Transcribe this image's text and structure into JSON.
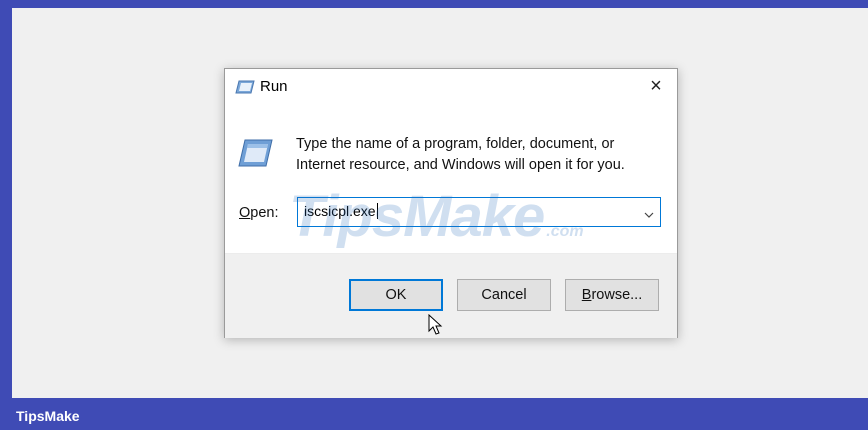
{
  "dialog": {
    "title": "Run",
    "close_symbol": "×",
    "icons": {
      "title": "run-icon",
      "body": "run-icon",
      "close": "close-icon",
      "dropdown": "chevron-down-icon"
    },
    "description_line1": "Type the name of a program, folder, document, or",
    "description_line2": "Internet resource, and Windows will open it for you.",
    "open_label_mnemonic": "O",
    "open_label_rest": "pen:",
    "open_value": "iscsicpl.exe",
    "buttons": {
      "ok": "OK",
      "cancel": "Cancel",
      "browse_mnemonic": "B",
      "browse_rest": "rowse..."
    }
  },
  "watermark": {
    "main": "TipsMake",
    "suffix": ".com"
  },
  "footer": {
    "brand": "TipsMake"
  },
  "colors": {
    "accent": "#0078d7",
    "brand_bar": "#3f4bb5"
  }
}
